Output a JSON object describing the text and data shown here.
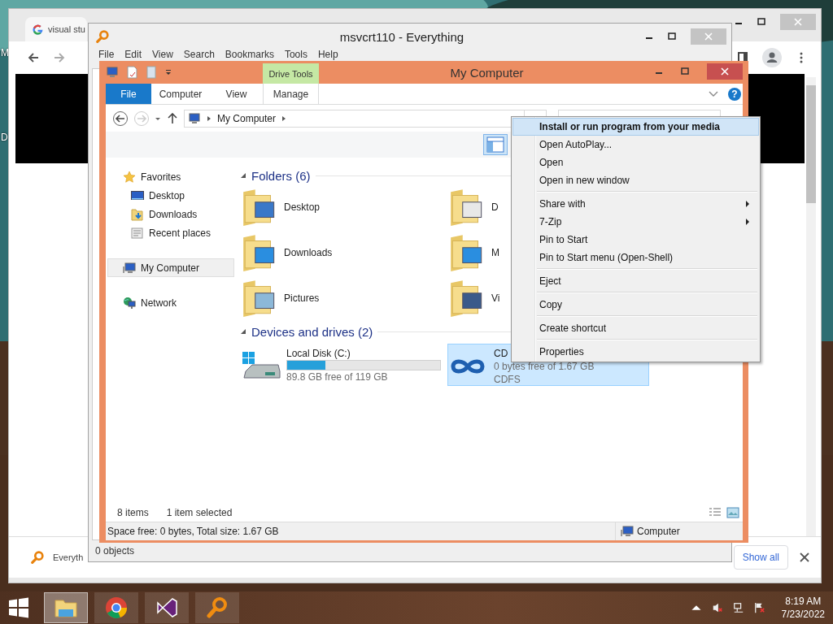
{
  "desktop": {
    "labels": [
      "M",
      "D"
    ]
  },
  "browser": {
    "tab": "visual stu",
    "downloads": {
      "item": "Everyth",
      "show_all": "Show all"
    }
  },
  "everything": {
    "title": "msvcrt110 - Everything",
    "menu": [
      "File",
      "Edit",
      "View",
      "Search",
      "Bookmarks",
      "Tools",
      "Help"
    ],
    "status": "0 objects"
  },
  "explorer": {
    "title": "My Computer",
    "tool_group": "Drive Tools",
    "help": "?",
    "ribbon_tabs": [
      {
        "label": "File",
        "kind": "app"
      },
      {
        "label": "Computer",
        "kind": "tab"
      },
      {
        "label": "View",
        "kind": "tab"
      },
      {
        "label": "Manage",
        "kind": "contextual"
      }
    ],
    "address": "My Computer",
    "nav": [
      {
        "label": "Favorites",
        "selected": false,
        "children": [
          {
            "label": "Desktop",
            "selected": false
          },
          {
            "label": "Downloads",
            "selected": false
          },
          {
            "label": "Recent places",
            "selected": false
          }
        ]
      },
      {
        "label": "My Computer",
        "selected": true
      },
      {
        "label": "Network",
        "selected": false
      }
    ],
    "folders": {
      "title": "Folders (6)",
      "items": [
        "Desktop",
        "D",
        "Downloads",
        "M",
        "Pictures",
        "Vi"
      ]
    },
    "drives": {
      "title": "Devices and drives (2)",
      "items": [
        {
          "name": "Local Disk (C:)",
          "selected": false,
          "level": 0.25,
          "info": "89.8 GB free of 119 GB"
        },
        {
          "name": "CD",
          "selected": true,
          "info": "0 bytes free of 1.67 GB",
          "file_system": "CDFS"
        }
      ]
    },
    "status": {
      "count": "8 items",
      "selection": "1 item selected"
    },
    "details": {
      "summary": "Space free: 0 bytes, Total size: 1.67 GB",
      "location": "Computer"
    }
  },
  "context_menu": [
    [
      {
        "label": "Install or run program from your media",
        "selected": true,
        "default": true,
        "submenu": false
      },
      {
        "label": "Open AutoPlay...",
        "selected": false,
        "default": false,
        "submenu": false
      },
      {
        "label": "Open",
        "selected": false,
        "default": false,
        "submenu": false
      },
      {
        "label": "Open in new window",
        "selected": false,
        "default": false,
        "submenu": false
      }
    ],
    [
      {
        "label": "Share with",
        "selected": false,
        "default": false,
        "submenu": true
      },
      {
        "label": "7-Zip",
        "selected": false,
        "default": false,
        "submenu": true
      },
      {
        "label": "Pin to Start",
        "selected": false,
        "default": false,
        "submenu": false
      },
      {
        "label": "Pin to Start menu (Open-Shell)",
        "selected": false,
        "default": false,
        "submenu": false
      }
    ],
    [
      {
        "label": "Eject",
        "selected": false,
        "default": false,
        "submenu": false
      }
    ],
    [
      {
        "label": "Copy",
        "selected": false,
        "default": false,
        "submenu": false
      }
    ],
    [
      {
        "label": "Create shortcut",
        "selected": false,
        "default": false,
        "submenu": false
      }
    ],
    [
      {
        "label": "Properties",
        "selected": false,
        "default": false,
        "submenu": false
      }
    ]
  ],
  "taskbar": {
    "apps": [
      {
        "selected": true
      },
      {
        "selected": false
      },
      {
        "selected": false
      },
      {
        "selected": false
      }
    ],
    "time": "8:19 AM",
    "date": "7/23/2022"
  }
}
